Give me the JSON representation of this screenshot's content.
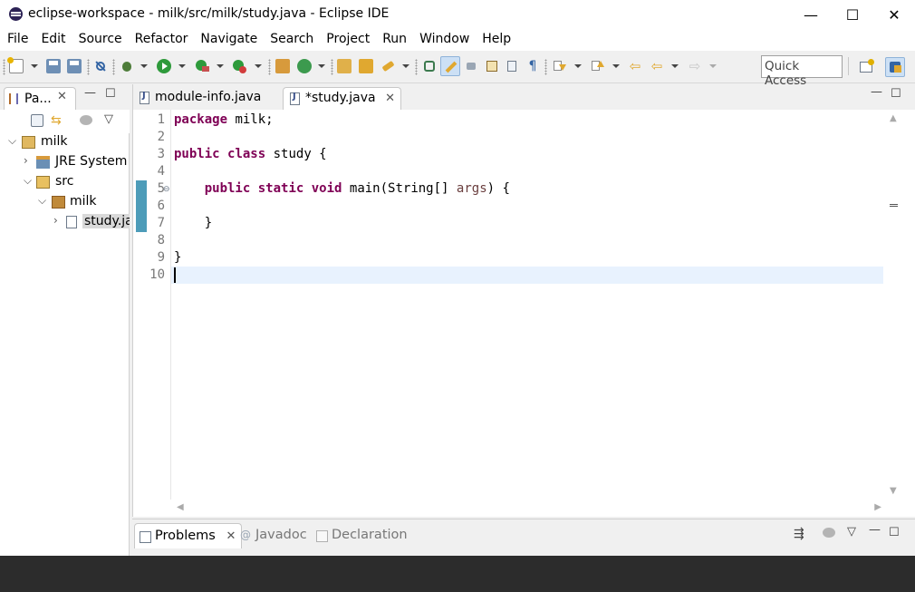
{
  "window": {
    "title": "eclipse-workspace - milk/src/milk/study.java - Eclipse IDE",
    "controls": {
      "minimize": "—",
      "maximize": "☐",
      "close": "✕"
    }
  },
  "menu": [
    "File",
    "Edit",
    "Source",
    "Refactor",
    "Navigate",
    "Search",
    "Project",
    "Run",
    "Window",
    "Help"
  ],
  "toolbar": {
    "quick_access_placeholder": "Quick Access",
    "icons": [
      "new-wizard-icon",
      "save-icon",
      "save-all-icon",
      "skip-breakpoints-icon",
      "debug-icon",
      "run-icon",
      "coverage-icon",
      "external-tools-icon",
      "new-java-package-icon",
      "new-java-class-icon",
      "open-type-icon",
      "open-task-icon",
      "search-icon",
      "toggle-ant-icon",
      "mark-occurrences-icon",
      "toggle-block-icon",
      "show-whitespace-icon",
      "next-annotation-icon",
      "previous-annotation-icon",
      "last-edit-icon",
      "back-icon",
      "forward-icon",
      "open-perspective-icon",
      "java-perspective-icon"
    ]
  },
  "package_explorer": {
    "tab_label": "Pa...",
    "tree": [
      {
        "label": "milk",
        "icon": "project-icon",
        "depth": 0,
        "expanded": true
      },
      {
        "label": "JRE System Library",
        "icon": "library-icon",
        "depth": 1,
        "expanded": false
      },
      {
        "label": "src",
        "icon": "source-folder-icon",
        "depth": 1,
        "expanded": true
      },
      {
        "label": "milk",
        "icon": "package-icon",
        "depth": 2,
        "expanded": true
      },
      {
        "label": "study.java",
        "icon": "java-file-icon",
        "depth": 3,
        "expanded": false,
        "selected": true
      }
    ]
  },
  "editor": {
    "tabs": [
      {
        "label": "module-info.java",
        "active": false
      },
      {
        "label": "*study.java",
        "active": true,
        "close": "✕"
      }
    ],
    "line_numbers": [
      "1",
      "2",
      "3",
      "4",
      "5",
      "6",
      "7",
      "8",
      "9",
      "10"
    ],
    "lines": {
      "l1_kw": "package",
      "l1_rest": " milk;",
      "l3_kw1": "public",
      "l3_kw2": "class",
      "l3_rest": " study {",
      "l5_indent": "    ",
      "l5_kw1": "public",
      "l5_kw2": "static",
      "l5_kw3": "void",
      "l5_mid": " main(String[] ",
      "l5_var": "args",
      "l5_end": ") {",
      "l7": "    }",
      "l9": "}"
    },
    "current_line": 10
  },
  "bottom_panel": {
    "tabs": [
      {
        "label": "Problems",
        "active": true
      },
      {
        "label": "Javadoc",
        "active": false
      },
      {
        "label": "Declaration",
        "active": false
      }
    ]
  },
  "colors": {
    "keyword": "#7f0055",
    "variable": "#6a3e3e",
    "current_line": "#e8f2fe",
    "change_ruler": "#4d9cb9"
  }
}
